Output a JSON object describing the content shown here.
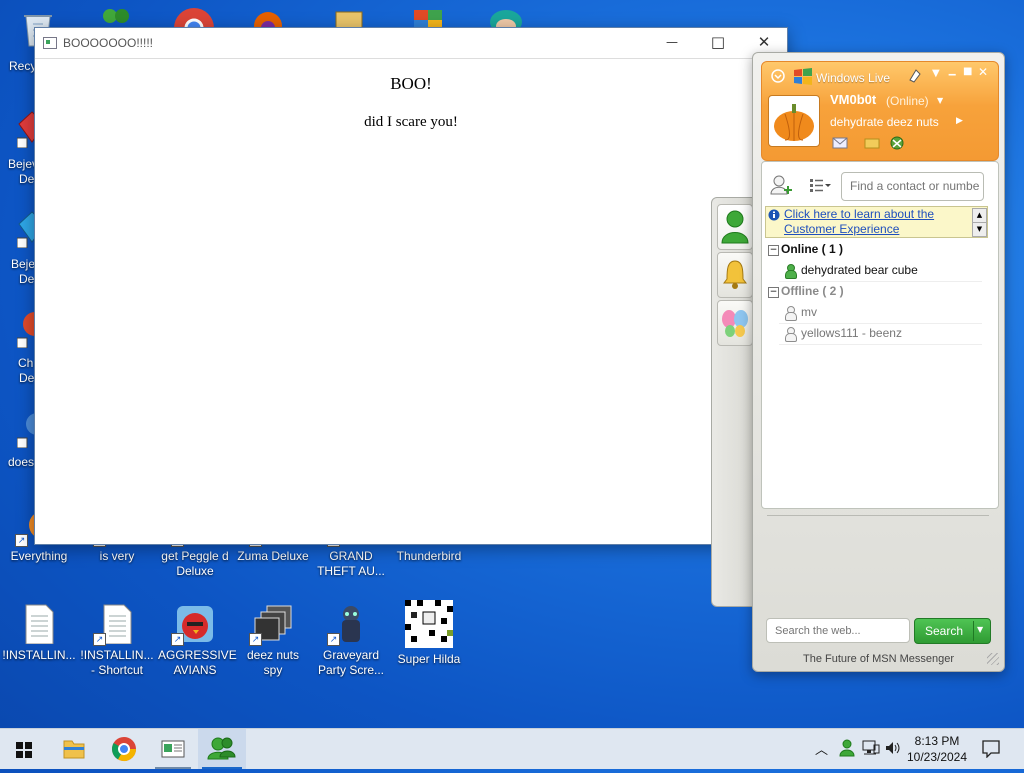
{
  "desktop": {
    "partial_labels": [
      "Recy",
      "Bejev",
      "De",
      "Beje",
      "De",
      "Ch",
      "De",
      "does"
    ],
    "icons_row1": [
      {
        "label": "Everything"
      },
      {
        "label": "is very"
      },
      {
        "label": "get Peggle d Deluxe"
      },
      {
        "label": "Zuma Deluxe"
      },
      {
        "label": "GRAND THEFT AU..."
      },
      {
        "label": "Thunderbird"
      }
    ],
    "icons_row2": [
      {
        "label": "!INSTALLIN..."
      },
      {
        "label": "!INSTALLIN... - Shortcut"
      },
      {
        "label": "AGGRESSIVE AVIANS"
      },
      {
        "label": "deez nuts spy"
      },
      {
        "label": "Graveyard Party Scre..."
      },
      {
        "label": "Super Hilda"
      }
    ]
  },
  "window": {
    "title": "BOOOOOOO!!!!!",
    "controls": {
      "minimize": "—",
      "maximize": "□",
      "close": "✕"
    },
    "heading": "BOO!",
    "text": "did I scare you!"
  },
  "messenger": {
    "brand": "Windows Live",
    "username": "VM0b0t",
    "status": "(Online)",
    "personal_message": "dehydrate deez nuts",
    "search_contacts_placeholder": "Find a contact or numbe",
    "notice": "Click here to learn about the Customer Experience",
    "groups": [
      {
        "name": "Online ( 1 )",
        "contacts": [
          {
            "name": "dehydrated bear cube",
            "online": true
          }
        ]
      },
      {
        "name": "Offline ( 2 )",
        "contacts": [
          {
            "name": "mv",
            "online": false
          },
          {
            "name": "yellows111 - beenz",
            "online": false
          }
        ]
      }
    ],
    "web_search_placeholder": "Search the web...",
    "search_button": "Search",
    "footer": "The Future of MSN Messenger"
  },
  "taskbar": {
    "time": "8:13 PM",
    "date": "10/23/2024"
  }
}
